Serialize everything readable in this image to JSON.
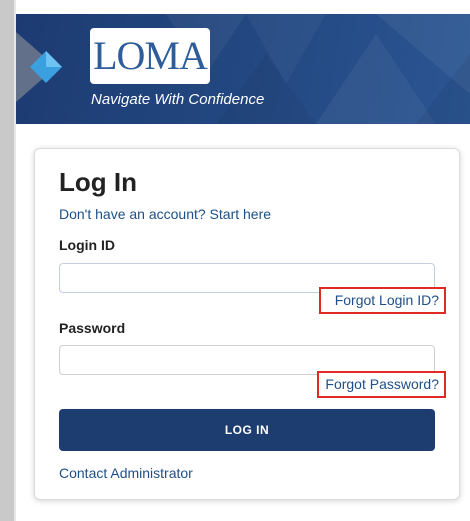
{
  "header": {
    "logo_text": "LOMA",
    "tagline": "Navigate With Confidence",
    "background_color": "#22467f"
  },
  "login_form": {
    "title": "Log In",
    "signup_link": "Don't have an account? Start here",
    "login_id_label": "Login ID",
    "login_id_value": "",
    "forgot_login_link": "Forgot Login ID?",
    "password_label": "Password",
    "password_value": "",
    "forgot_password_link": "Forgot Password?",
    "submit_label": "LOG IN",
    "contact_link": "Contact Administrator"
  },
  "colors": {
    "accent": "#1d3d70",
    "link": "#1f4f87",
    "highlight_border": "#e02a24"
  },
  "icons": {
    "brand_mark": "diamond-icon"
  }
}
